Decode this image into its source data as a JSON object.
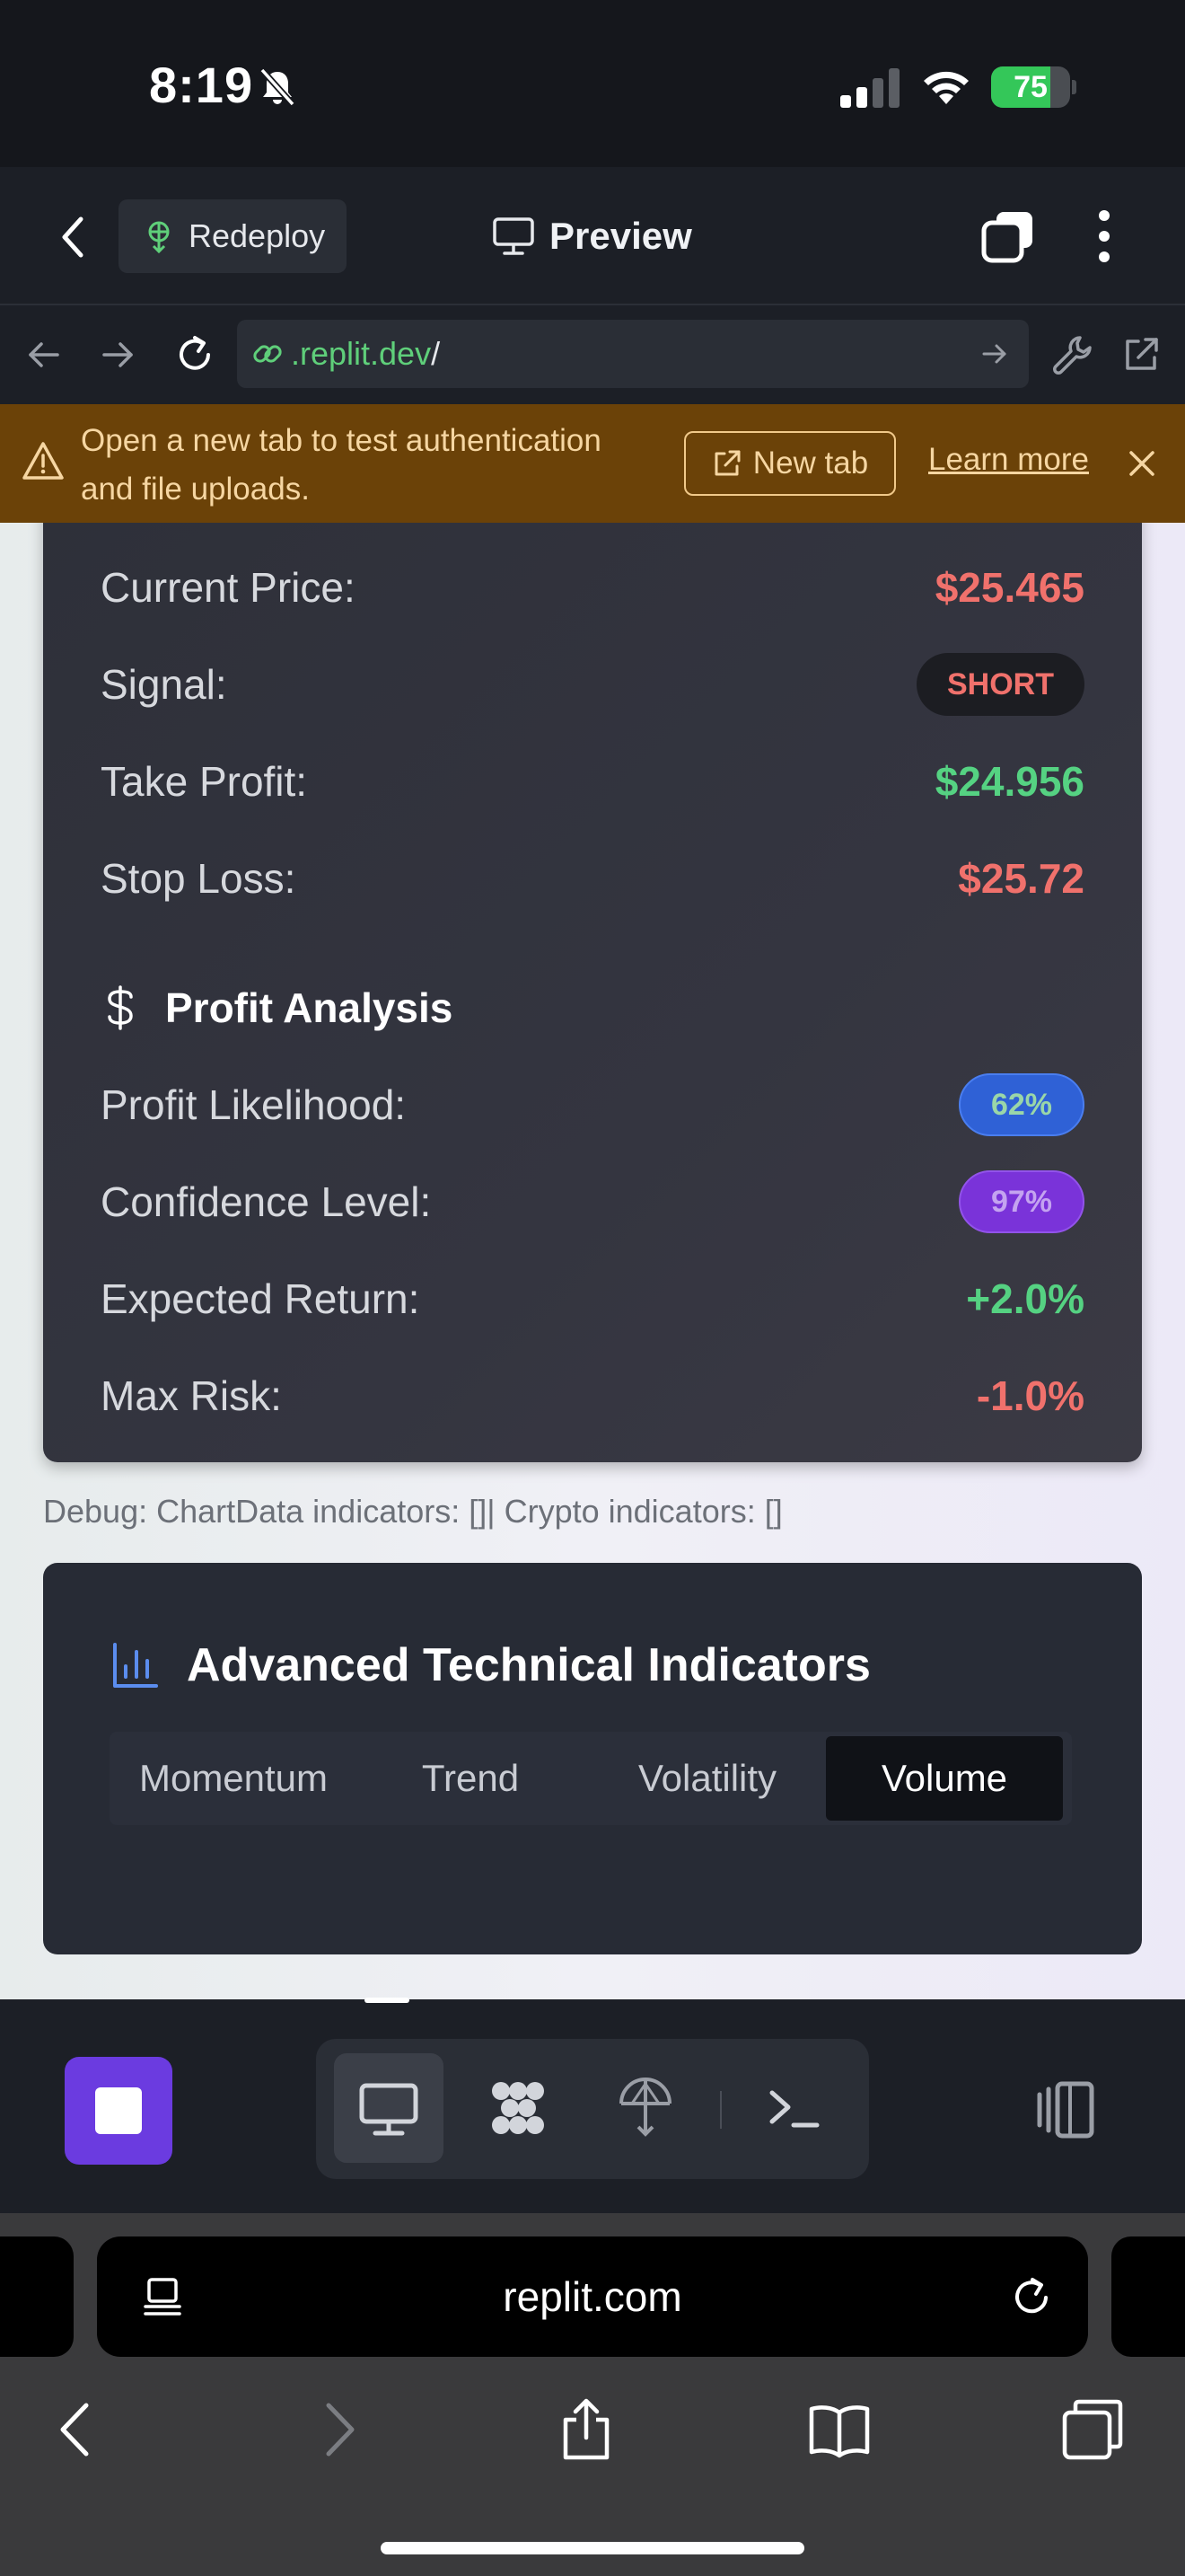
{
  "status_bar": {
    "time": "8:19",
    "battery": "75",
    "battery_level": 0.75
  },
  "replit_header": {
    "redeploy_label": "Redeploy",
    "preview_label": "Preview"
  },
  "url_bar": {
    "host": ".replit.dev",
    "path": "/"
  },
  "warning_banner": {
    "message": "Open a new tab to test authentication and file uploads.",
    "new_tab_label": "New tab",
    "learn_more_label": "Learn more"
  },
  "trade": {
    "current_price_label": "Current Price:",
    "current_price": "$25.465",
    "signal_label": "Signal:",
    "signal": "SHORT",
    "take_profit_label": "Take Profit:",
    "take_profit": "$24.956",
    "stop_loss_label": "Stop Loss:",
    "stop_loss": "$25.72"
  },
  "profit_analysis": {
    "title": "Profit Analysis",
    "likelihood_label": "Profit Likelihood:",
    "likelihood": "62%",
    "confidence_label": "Confidence Level:",
    "confidence": "97%",
    "expected_return_label": "Expected Return:",
    "expected_return": "+2.0%",
    "max_risk_label": "Max Risk:",
    "max_risk": "-1.0%"
  },
  "debug": "Debug: ChartData indicators: []| Crypto indicators: []",
  "indicators": {
    "title": "Advanced Technical Indicators",
    "tabs": [
      {
        "label": "Momentum",
        "active": false
      },
      {
        "label": "Trend",
        "active": false
      },
      {
        "label": "Volatility",
        "active": false
      },
      {
        "label": "Volume",
        "active": true
      }
    ]
  },
  "safari": {
    "address": "replit.com"
  },
  "colors": {
    "accent_purple": "#6b3be0",
    "negative": "#f0716c",
    "positive": "#55d282",
    "warning_bg": "#6b4208"
  }
}
